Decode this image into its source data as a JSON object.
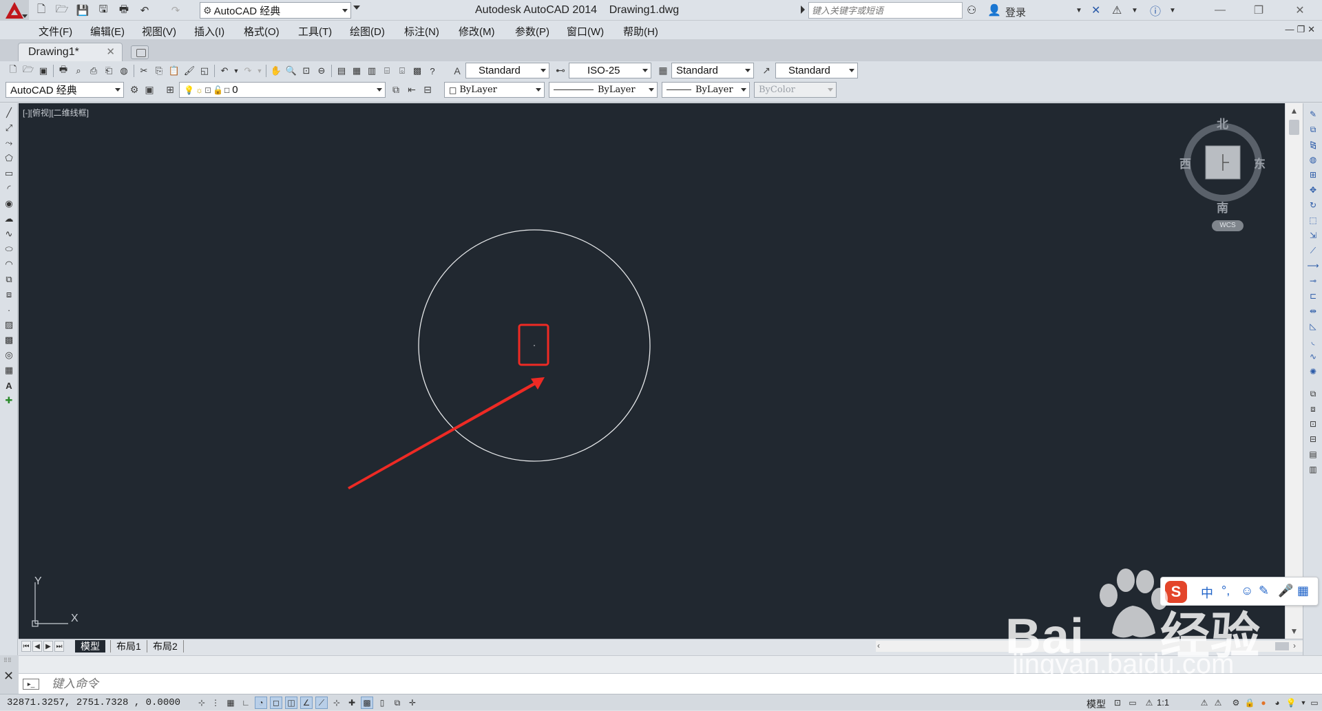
{
  "colors": {
    "canvas_bg": "#212830",
    "drawing_line": "#e6e8ea",
    "annotation_red": "#ee2a24",
    "autocad_red": "#c0161b",
    "ime_orange": "#e3452a"
  },
  "titlebar": {
    "workspace": "AutoCAD 经典",
    "title": "Autodesk AutoCAD 2014    Drawing1.dwg",
    "search_placeholder": "键入关键字或短语",
    "login": "登录"
  },
  "menubar": {
    "items": [
      "文件(F)",
      "编辑(E)",
      "视图(V)",
      "插入(I)",
      "格式(O)",
      "工具(T)",
      "绘图(D)",
      "标注(N)",
      "修改(M)",
      "参数(P)",
      "窗口(W)",
      "帮助(H)"
    ]
  },
  "tabs": {
    "document": "Drawing1*"
  },
  "styles_toolbar": {
    "text_style": "Standard",
    "dim_style": "ISO-25",
    "table_style": "Standard",
    "multileader_style": "Standard"
  },
  "layers_toolbar": {
    "workspace": "AutoCAD 经典",
    "current_layer": "0",
    "color": "ByLayer",
    "linetype": "ByLayer",
    "lineweight": "ByLayer",
    "plot_style": "ByColor"
  },
  "canvas": {
    "viewport_label": "[-][俯视][二维线框]",
    "ucs_x": "X",
    "ucs_y": "Y"
  },
  "viewcube": {
    "north": "北",
    "south": "南",
    "east": "东",
    "west": "西",
    "face": "上",
    "wcs": "WCS"
  },
  "layout_tabs": [
    "模型",
    "布局1",
    "布局2"
  ],
  "command": {
    "placeholder": "键入命令"
  },
  "statusbar": {
    "coordinates": "32871.3257, 2751.7328 , 0.0000",
    "model": "模型",
    "scale": "1:1"
  },
  "ime": {
    "logo": "S",
    "lang": "中"
  },
  "watermark": {
    "brand": "Bai",
    "brand_tail": "经验",
    "url": "jingyan.baidu.com"
  }
}
